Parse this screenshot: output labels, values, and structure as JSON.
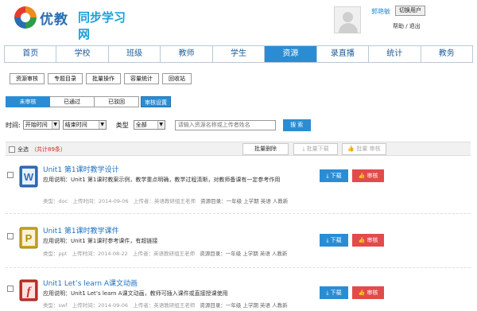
{
  "header": {
    "logo_main": "优教",
    "logo_sub": "同步学习网",
    "username": "郭艳敏",
    "switch_user": "切换用户",
    "help_logout": "帮助 / 退出"
  },
  "nav": {
    "items": [
      "首页",
      "学校",
      "班级",
      "教师",
      "学生",
      "资源",
      "录直播",
      "统计",
      "教务"
    ],
    "active": "资源"
  },
  "subtabs": [
    "资源审核",
    "专题目录",
    "批量操作",
    "容量统计",
    "回收站"
  ],
  "status_tabs": {
    "items": [
      "未审核",
      "已通过",
      "已驳回"
    ],
    "active": "未审核",
    "settings": "审核设置"
  },
  "filter": {
    "time_label": "时间:",
    "start_time": "开始时间",
    "end_time": "结束时间",
    "type_label": "类型",
    "type_value": "全部",
    "search_placeholder": "请输入资源名称或上传者姓名",
    "search_button": "搜 索"
  },
  "toolbar": {
    "select_all": "全选",
    "total": "（共计89条）",
    "bulk_delete": "批量删除",
    "bulk_download": "批量下载",
    "bulk_audit": "批量 审核"
  },
  "items": [
    {
      "title": "Unit1 第1课时教学设计",
      "desc": "应用说明：Unit1 第1课时教案示例，教学重点明确，教学过程清晰，对教师备课有一定参考作用",
      "type": "类型：doc",
      "upload_time": "上传时间：2014-09-06",
      "uploader": "上传者：英语教研组王老师",
      "dir": "资源目录：一年级 上学期 英语 人教新",
      "icon": "word-icon",
      "download": "下载",
      "audit": "审核"
    },
    {
      "title": "Unit1 第1课时教学课件",
      "desc": "应用说明：Unit1 第1课时参考课件，有超链接",
      "type": "类型：ppt",
      "upload_time": "上传时间：2014-08-22",
      "uploader": "上传者：英语教研组王老师",
      "dir": "资源目录：一年级 上学期 英语 人教新",
      "icon": "powerpoint-icon",
      "download": "下载",
      "audit": "审核"
    },
    {
      "title": "Unit1 Let’s learn A课文动画",
      "desc": "应用说明：Unit1 Let’s learn A课文动画，教师可插入课件或直接授课使用",
      "type": "类型：swf",
      "upload_time": "上传时间：2014-09-06",
      "uploader": "上传者：英语教研组王老师",
      "dir": "资源目录：一年级 上学期 英语 人教新",
      "icon": "flash-icon",
      "download": "下载",
      "audit": "审核"
    }
  ],
  "colors": {
    "accent_blue": "#2a8dd4",
    "audit_red": "#e24b4b",
    "total_red": "#e02222"
  }
}
